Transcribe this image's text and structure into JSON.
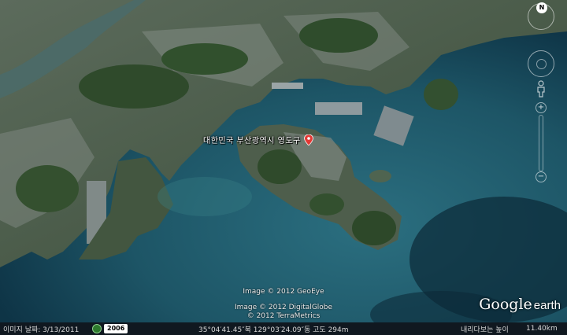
{
  "placemark": {
    "label": "대한민국 부산광역시 영도구",
    "icon": "red-pin-icon",
    "pin_color": "#e53935"
  },
  "credits": [
    "Image © 2012 GeoEye",
    "Image © 2012 DigitalGlobe",
    "© 2012 TerraMetrics"
  ],
  "logo": {
    "google": "Google",
    "earth": "earth"
  },
  "navigation": {
    "compass_north": "N",
    "zoom_in": "+",
    "zoom_out": "−",
    "icons": [
      "compass-icon",
      "look-ring-icon",
      "pegman-icon",
      "zoom-slider-icon"
    ]
  },
  "statusbar": {
    "image_date": "이미지 날짜: 3/13/2011",
    "history_icon": "clock-icon",
    "year_badge": "2006",
    "coordinates": "35°04′41.45″북 129°03′24.09″동 고도  294m",
    "eye_alt_label": "내리다보는 높이",
    "eye_alt": "11.40km"
  },
  "colors": {
    "sea": "#1f5a6e",
    "deep_sea": "#0e2f40",
    "land": "#3f5a3a",
    "city": "#6e7a72"
  }
}
